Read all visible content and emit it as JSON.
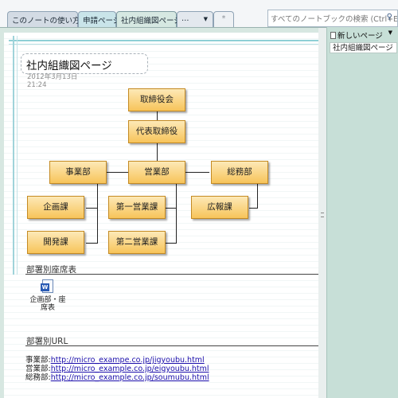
{
  "tabs": [
    {
      "label": "このノートの使い方"
    },
    {
      "label": "申請ページ"
    },
    {
      "label": "社内組織図ページ"
    },
    {
      "label": "…"
    },
    {
      "label": "*"
    }
  ],
  "search": {
    "placeholder": "すべてのノートブックの検索 (Ctrl+E)",
    "icon": "search-icon"
  },
  "page": {
    "title": "社内組織図ページ",
    "date": "2012年3月13日",
    "time": "21:24"
  },
  "org_chart": {
    "nodes": [
      {
        "id": "board",
        "label": "取締役会"
      },
      {
        "id": "ceo",
        "label": "代表取締役"
      },
      {
        "id": "jigyo",
        "label": "事業部"
      },
      {
        "id": "eigyo",
        "label": "営業部"
      },
      {
        "id": "somu",
        "label": "総務部"
      },
      {
        "id": "kikaku",
        "label": "企画課"
      },
      {
        "id": "dai1",
        "label": "第一営業課"
      },
      {
        "id": "koho",
        "label": "広報課"
      },
      {
        "id": "kaihatsu",
        "label": "開発課"
      },
      {
        "id": "dai2",
        "label": "第二営業課"
      }
    ]
  },
  "sections": {
    "seating_heading": "部署別座席表",
    "attachment_label": "企画部・座席表",
    "url_heading": "部署別URL"
  },
  "urls": [
    {
      "dept": "事業部:",
      "url": "http://micro_exampe.co.jp/jigyoubu.html"
    },
    {
      "dept": "営業部:",
      "url": "http://micro_example.co.jp/eigyoubu.html"
    },
    {
      "dept": "総務部:",
      "url": "http://micro_example.co.jp/soumubu.html"
    }
  ],
  "sidebar": {
    "new_page_label": "新しいページ",
    "pages": [
      {
        "label": "社内組織図ページ"
      }
    ]
  },
  "colors": {
    "node_fill_top": "#fde9b7",
    "node_fill_bottom": "#f7c45a",
    "page_background": "#d7e7e1",
    "link": "#1a0dab"
  }
}
